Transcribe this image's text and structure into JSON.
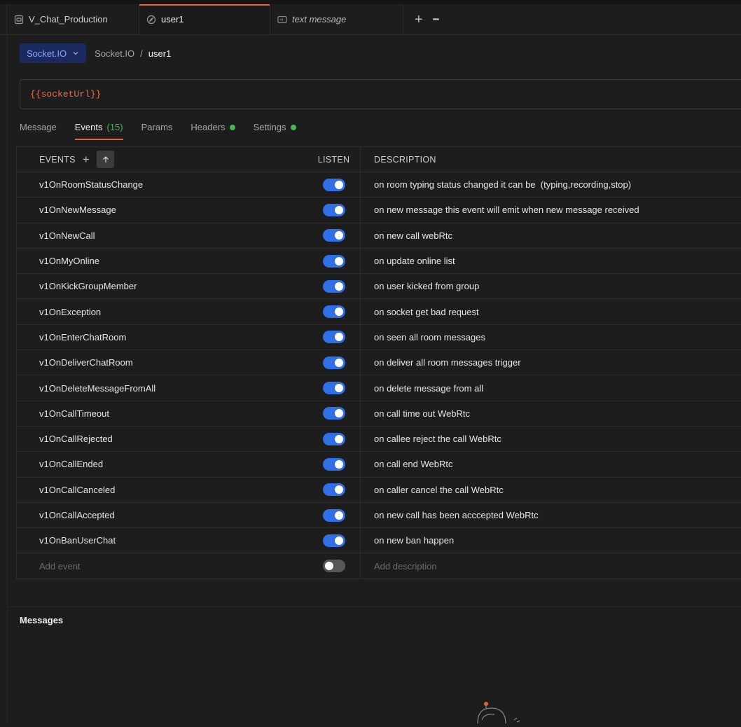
{
  "tabs": [
    {
      "label": "V_Chat_Production",
      "icon": "collection-icon",
      "italic": false,
      "active": false
    },
    {
      "label": "user1",
      "icon": "socketio-icon",
      "italic": false,
      "active": true
    },
    {
      "label": "text message",
      "icon": "message-icon",
      "italic": true,
      "active": false
    }
  ],
  "tab_actions": {
    "new_tab": "+",
    "more": "•••"
  },
  "request": {
    "protocol": "Socket.IO",
    "breadcrumb_parent": "Socket.IO",
    "breadcrumb_separator": "/",
    "breadcrumb_current": "user1",
    "url": "{{socketUrl}}"
  },
  "subtabs": [
    {
      "label": "Message",
      "count": "",
      "dot": false,
      "active": false
    },
    {
      "label": "Events",
      "count": "(15)",
      "dot": false,
      "active": true
    },
    {
      "label": "Params",
      "count": "",
      "dot": false,
      "active": false
    },
    {
      "label": "Headers",
      "count": "",
      "dot": true,
      "active": false
    },
    {
      "label": "Settings",
      "count": "",
      "dot": true,
      "active": false
    }
  ],
  "table": {
    "col_events": "EVENTS",
    "col_listen": "LISTEN",
    "col_description": "DESCRIPTION",
    "add_icon": "+",
    "rows": [
      {
        "event": "v1OnRoomStatusChange",
        "listen": true,
        "description": "on room typing status changed it can be  (typing,recording,stop)"
      },
      {
        "event": "v1OnNewMessage",
        "listen": true,
        "description": "on new message this event will emit when new message received"
      },
      {
        "event": "v1OnNewCall",
        "listen": true,
        "description": "on new call webRtc"
      },
      {
        "event": "v1OnMyOnline",
        "listen": true,
        "description": "on update online list"
      },
      {
        "event": "v1OnKickGroupMember",
        "listen": true,
        "description": "on user kicked from group"
      },
      {
        "event": "v1OnException",
        "listen": true,
        "description": "on socket get bad request"
      },
      {
        "event": "v1OnEnterChatRoom",
        "listen": true,
        "description": "on seen all room messages"
      },
      {
        "event": "v1OnDeliverChatRoom",
        "listen": true,
        "description": "on deliver all room messages trigger"
      },
      {
        "event": "v1OnDeleteMessageFromAll",
        "listen": true,
        "description": "on delete message from all"
      },
      {
        "event": "v1OnCallTimeout",
        "listen": true,
        "description": "on call time out WebRtc"
      },
      {
        "event": "v1OnCallRejected",
        "listen": true,
        "description": "on callee reject the call WebRtc"
      },
      {
        "event": "v1OnCallEnded",
        "listen": true,
        "description": "on call end WebRtc"
      },
      {
        "event": "v1OnCallCanceled",
        "listen": true,
        "description": "on caller cancel the call WebRtc"
      },
      {
        "event": "v1OnCallAccepted",
        "listen": true,
        "description": "on new call has been acccepted WebRtc"
      },
      {
        "event": "v1OnBanUserChat",
        "listen": true,
        "description": "on new ban happen"
      }
    ],
    "add_row": {
      "event_placeholder": "Add event",
      "listen": false,
      "description_placeholder": "Add description"
    }
  },
  "messages": {
    "title": "Messages"
  },
  "colors": {
    "accent": "#e8613c",
    "toggle_on": "#2f6fe8",
    "status_dot": "#3fb950",
    "url_text": "#ef6b4a"
  }
}
